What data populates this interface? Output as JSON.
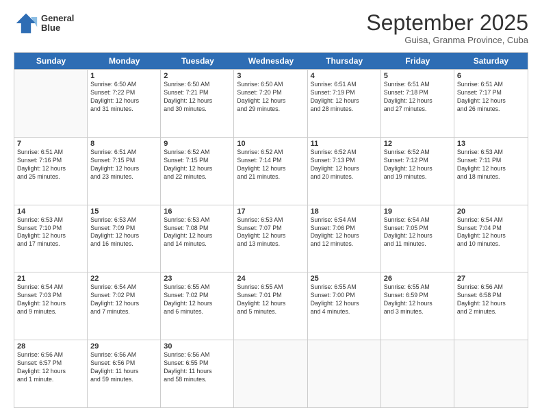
{
  "logo": {
    "line1": "General",
    "line2": "Blue"
  },
  "title": "September 2025",
  "subtitle": "Guisa, Granma Province, Cuba",
  "header_days": [
    "Sunday",
    "Monday",
    "Tuesday",
    "Wednesday",
    "Thursday",
    "Friday",
    "Saturday"
  ],
  "weeks": [
    [
      {
        "day": "",
        "info": ""
      },
      {
        "day": "1",
        "info": "Sunrise: 6:50 AM\nSunset: 7:22 PM\nDaylight: 12 hours\nand 31 minutes."
      },
      {
        "day": "2",
        "info": "Sunrise: 6:50 AM\nSunset: 7:21 PM\nDaylight: 12 hours\nand 30 minutes."
      },
      {
        "day": "3",
        "info": "Sunrise: 6:50 AM\nSunset: 7:20 PM\nDaylight: 12 hours\nand 29 minutes."
      },
      {
        "day": "4",
        "info": "Sunrise: 6:51 AM\nSunset: 7:19 PM\nDaylight: 12 hours\nand 28 minutes."
      },
      {
        "day": "5",
        "info": "Sunrise: 6:51 AM\nSunset: 7:18 PM\nDaylight: 12 hours\nand 27 minutes."
      },
      {
        "day": "6",
        "info": "Sunrise: 6:51 AM\nSunset: 7:17 PM\nDaylight: 12 hours\nand 26 minutes."
      }
    ],
    [
      {
        "day": "7",
        "info": "Sunrise: 6:51 AM\nSunset: 7:16 PM\nDaylight: 12 hours\nand 25 minutes."
      },
      {
        "day": "8",
        "info": "Sunrise: 6:51 AM\nSunset: 7:15 PM\nDaylight: 12 hours\nand 23 minutes."
      },
      {
        "day": "9",
        "info": "Sunrise: 6:52 AM\nSunset: 7:15 PM\nDaylight: 12 hours\nand 22 minutes."
      },
      {
        "day": "10",
        "info": "Sunrise: 6:52 AM\nSunset: 7:14 PM\nDaylight: 12 hours\nand 21 minutes."
      },
      {
        "day": "11",
        "info": "Sunrise: 6:52 AM\nSunset: 7:13 PM\nDaylight: 12 hours\nand 20 minutes."
      },
      {
        "day": "12",
        "info": "Sunrise: 6:52 AM\nSunset: 7:12 PM\nDaylight: 12 hours\nand 19 minutes."
      },
      {
        "day": "13",
        "info": "Sunrise: 6:53 AM\nSunset: 7:11 PM\nDaylight: 12 hours\nand 18 minutes."
      }
    ],
    [
      {
        "day": "14",
        "info": "Sunrise: 6:53 AM\nSunset: 7:10 PM\nDaylight: 12 hours\nand 17 minutes."
      },
      {
        "day": "15",
        "info": "Sunrise: 6:53 AM\nSunset: 7:09 PM\nDaylight: 12 hours\nand 16 minutes."
      },
      {
        "day": "16",
        "info": "Sunrise: 6:53 AM\nSunset: 7:08 PM\nDaylight: 12 hours\nand 14 minutes."
      },
      {
        "day": "17",
        "info": "Sunrise: 6:53 AM\nSunset: 7:07 PM\nDaylight: 12 hours\nand 13 minutes."
      },
      {
        "day": "18",
        "info": "Sunrise: 6:54 AM\nSunset: 7:06 PM\nDaylight: 12 hours\nand 12 minutes."
      },
      {
        "day": "19",
        "info": "Sunrise: 6:54 AM\nSunset: 7:05 PM\nDaylight: 12 hours\nand 11 minutes."
      },
      {
        "day": "20",
        "info": "Sunrise: 6:54 AM\nSunset: 7:04 PM\nDaylight: 12 hours\nand 10 minutes."
      }
    ],
    [
      {
        "day": "21",
        "info": "Sunrise: 6:54 AM\nSunset: 7:03 PM\nDaylight: 12 hours\nand 9 minutes."
      },
      {
        "day": "22",
        "info": "Sunrise: 6:54 AM\nSunset: 7:02 PM\nDaylight: 12 hours\nand 7 minutes."
      },
      {
        "day": "23",
        "info": "Sunrise: 6:55 AM\nSunset: 7:02 PM\nDaylight: 12 hours\nand 6 minutes."
      },
      {
        "day": "24",
        "info": "Sunrise: 6:55 AM\nSunset: 7:01 PM\nDaylight: 12 hours\nand 5 minutes."
      },
      {
        "day": "25",
        "info": "Sunrise: 6:55 AM\nSunset: 7:00 PM\nDaylight: 12 hours\nand 4 minutes."
      },
      {
        "day": "26",
        "info": "Sunrise: 6:55 AM\nSunset: 6:59 PM\nDaylight: 12 hours\nand 3 minutes."
      },
      {
        "day": "27",
        "info": "Sunrise: 6:56 AM\nSunset: 6:58 PM\nDaylight: 12 hours\nand 2 minutes."
      }
    ],
    [
      {
        "day": "28",
        "info": "Sunrise: 6:56 AM\nSunset: 6:57 PM\nDaylight: 12 hours\nand 1 minute."
      },
      {
        "day": "29",
        "info": "Sunrise: 6:56 AM\nSunset: 6:56 PM\nDaylight: 11 hours\nand 59 minutes."
      },
      {
        "day": "30",
        "info": "Sunrise: 6:56 AM\nSunset: 6:55 PM\nDaylight: 11 hours\nand 58 minutes."
      },
      {
        "day": "",
        "info": ""
      },
      {
        "day": "",
        "info": ""
      },
      {
        "day": "",
        "info": ""
      },
      {
        "day": "",
        "info": ""
      }
    ]
  ]
}
